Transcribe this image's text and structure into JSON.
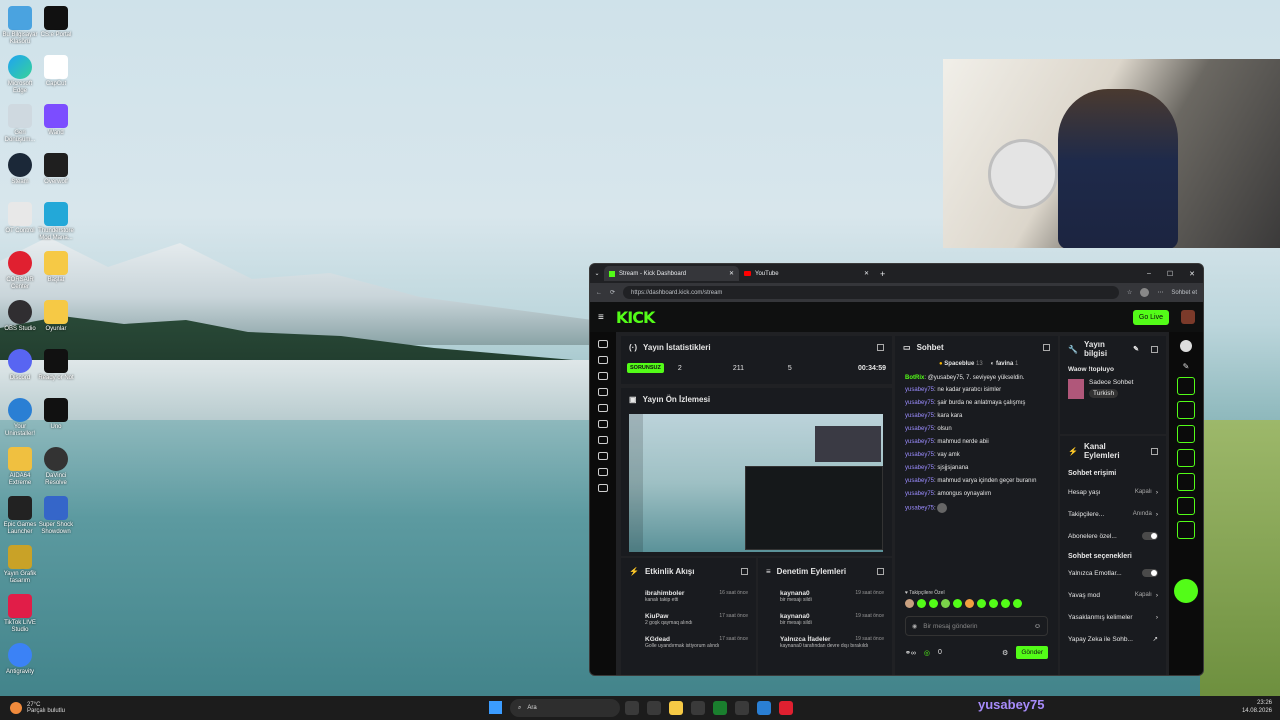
{
  "desktop": {
    "icons_left": [
      "Bu Bilgisayar Klasörü",
      "Microsoft Edge",
      "Geri Dönüşüm...",
      "Steam",
      "OT Control",
      "CORSAIR Center",
      "OBS Studio",
      "Discord",
      "Your Uninstaller!",
      "AIDA64 Extreme",
      "Epic Games Launcher",
      "Yayın Grafik tasarım",
      "TikTok LIVE Studio",
      "Antigravity"
    ],
    "icons_right": [
      "CS:e Portal",
      "CapCut",
      "Wand",
      "Overwolf",
      "Thunderstore Mod Mana...",
      "Başlat",
      "Oyunlar",
      "Ready or Not",
      "Uno",
      "DaVinci Resolve",
      "Super Shock Showdown"
    ],
    "streamer_name": "yusabey75"
  },
  "browser": {
    "tabs": [
      {
        "label": "Stream - Kick Dashboard",
        "active": true
      },
      {
        "label": "YouTube",
        "active": false
      }
    ],
    "url": "https://dashboard.kick.com/stream",
    "sohbet_et": "Sohbet et"
  },
  "kick": {
    "logo": "KICK",
    "go_live": "Go Live",
    "stats": {
      "title": "Yayın İstatistikleri",
      "status": "SORUNSUZ",
      "values": [
        "2",
        "211",
        "5",
        "00:34:59"
      ]
    },
    "preview_title": "Yayın Ön İzlemesi",
    "activity": {
      "title": "Etkinlik Akışı",
      "items": [
        {
          "user": "ibrahimboler",
          "time": "16 saat önce",
          "sub": "kanalı takip etti"
        },
        {
          "user": "KiuPaw",
          "time": "17 saat önce",
          "sub": "2 goşk qaymaq alındı"
        },
        {
          "user": "KGdead",
          "time": "17 saat önce",
          "sub": "Golle uyandırmak istiyorum alındı"
        }
      ]
    },
    "moderation": {
      "title": "Denetim Eylemleri",
      "items": [
        {
          "user": "kaynana0",
          "time": "19 saat önce",
          "sub": "bir mesajı sildi"
        },
        {
          "user": "kaynana0",
          "time": "19 saat önce",
          "sub": "bir mesajı sildi"
        },
        {
          "user": "Yalnızca İfadeler",
          "time": "19 saat önce",
          "sub": "kaynana0 tarafından devre dışı bırakıldı"
        }
      ]
    },
    "chat": {
      "title": "Sohbet",
      "top_users": [
        {
          "name": "Spaceblue",
          "count": "13"
        },
        {
          "name": "favina",
          "count": "1"
        }
      ],
      "messages": [
        {
          "user": "BotRix",
          "text": "@yusabey75, 7. seviyeye yükseldin."
        },
        {
          "user": "yusabey75",
          "text": "ne kadar yaratıcı isimler"
        },
        {
          "user": "yusabey75",
          "text": "şair burda ne anlatmaya çalışmış"
        },
        {
          "user": "yusabey75",
          "text": "kara kara"
        },
        {
          "user": "yusabey75",
          "text": "olsun"
        },
        {
          "user": "yusabey75",
          "text": "mahmud nerde abii"
        },
        {
          "user": "yusabey75",
          "text": "vay amk"
        },
        {
          "user": "yusabey75",
          "text": "sjsjjsjanana"
        },
        {
          "user": "yusabey75",
          "text": "mahmud varya içinden geçer buranın"
        },
        {
          "user": "yusabey75",
          "text": "amongus oynayalım"
        },
        {
          "user": "yusabey75",
          "text": ""
        }
      ],
      "followers_only": "Takipçilere Özel",
      "placeholder": "Bir mesaj gönderin",
      "count": "0",
      "send": "Gönder"
    },
    "stream_info": {
      "title": "Yayın bilgisi",
      "stream_title": "Waow !topluyo",
      "category": "Sadece Sohbet",
      "language": "Turkish"
    },
    "channel_actions": {
      "title": "Kanal Eylemleri",
      "chat_access_title": "Sohbet erişimi",
      "access_rows": [
        {
          "label": "Hesap yaşı",
          "value": "Kapalı"
        },
        {
          "label": "Takipçilere...",
          "value": "Anında"
        },
        {
          "label": "Abonelere özel...",
          "value": ""
        }
      ],
      "chat_options_title": "Sohbet seçenekleri",
      "option_rows": [
        {
          "label": "Yalnızca Emotlar...",
          "value": ""
        },
        {
          "label": "Yavaş mod",
          "value": "Kapalı"
        },
        {
          "label": "Yasaklanmış kelimeler",
          "value": ""
        },
        {
          "label": "Yapay Zeka ile Sohb...",
          "value": ""
        }
      ]
    }
  },
  "taskbar": {
    "weather_temp": "27°C",
    "weather_desc": "Parçalı bulutlu",
    "search": "Ara",
    "time": "23:26",
    "date": "14.08.2026"
  },
  "colors": {
    "kick_green": "#53fc18",
    "chat_user": "#9b8cff"
  }
}
